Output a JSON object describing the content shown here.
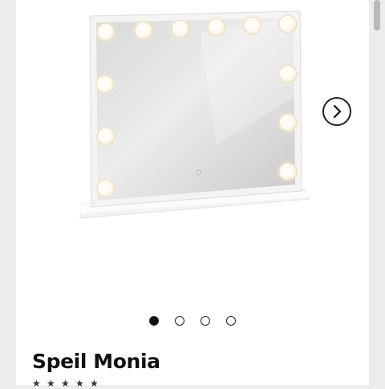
{
  "product": {
    "title": "Speil Monia",
    "rating_stars": 5
  },
  "gallery": {
    "total_images": 4,
    "active_index": 0,
    "next_icon": "chevron-right-icon"
  },
  "colors": {
    "dot_active": "#111111",
    "bulb_glow": "#fff6e6",
    "mirror_frame": "#f4f4f4"
  }
}
